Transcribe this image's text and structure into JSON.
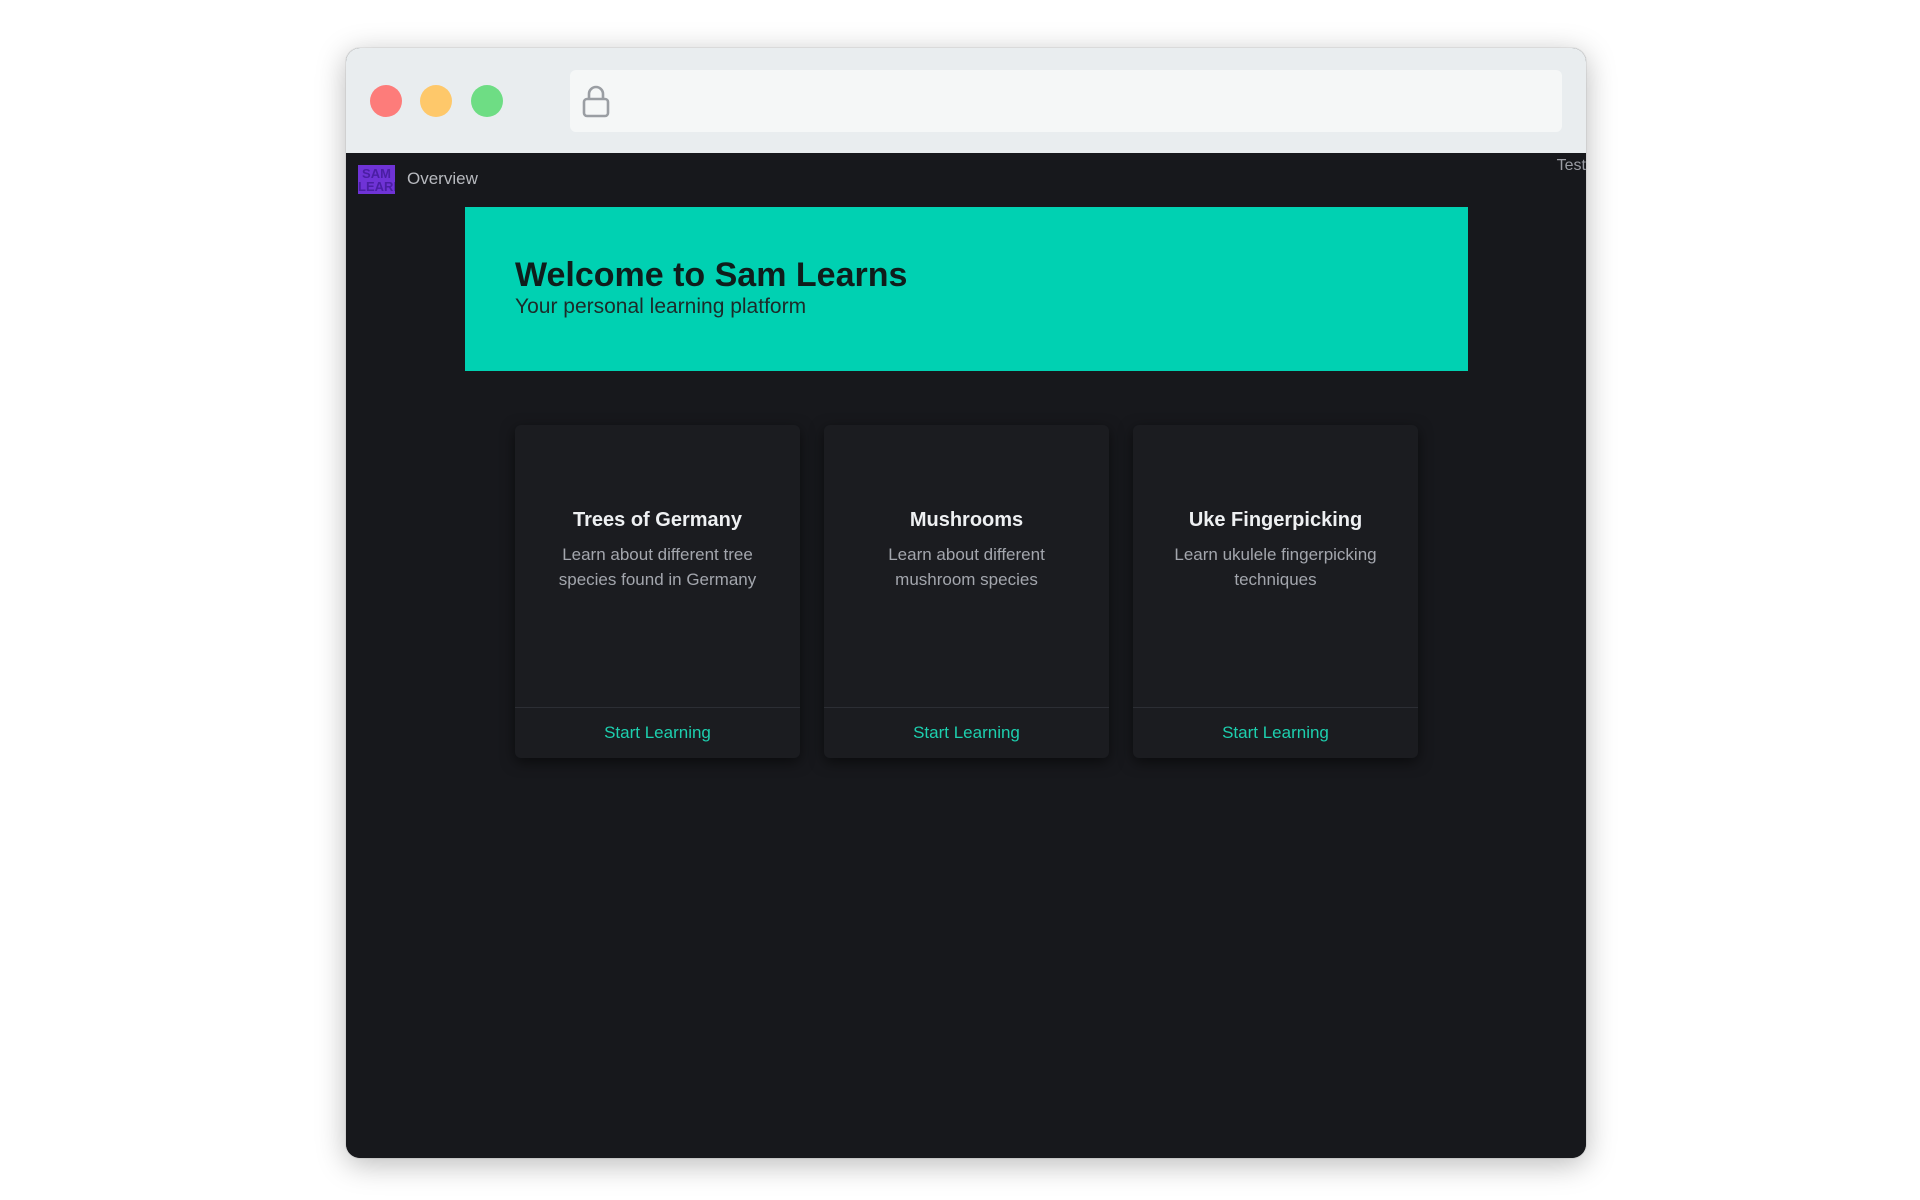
{
  "browser": {
    "address_value": "",
    "icons": {
      "lock": "lock-icon"
    },
    "traffic_lights": [
      "#fd7c7a",
      "#fec86a",
      "#6edd84"
    ]
  },
  "nav": {
    "logo_text": "SAM LEARNS",
    "overview_label": "Overview",
    "right_label": "Test"
  },
  "hero": {
    "title": "Welcome to Sam Learns",
    "subtitle": "Your personal learning platform",
    "background": "#00d1b2"
  },
  "courses": [
    {
      "title": "Trees of Germany",
      "description": "Learn about different tree species found in Germany",
      "link": "Start Learning"
    },
    {
      "title": "Mushrooms",
      "description": "Learn about different mushroom species",
      "link": "Start Learning"
    },
    {
      "title": "Uke Fingerpicking",
      "description": "Learn ukulele fingerpicking techniques",
      "link": "Start Learning"
    }
  ],
  "colors": {
    "accent": "#1dcfae",
    "page_bg": "#17181c",
    "card_bg": "#1b1c20",
    "logo_bg": "#6f33d6"
  }
}
